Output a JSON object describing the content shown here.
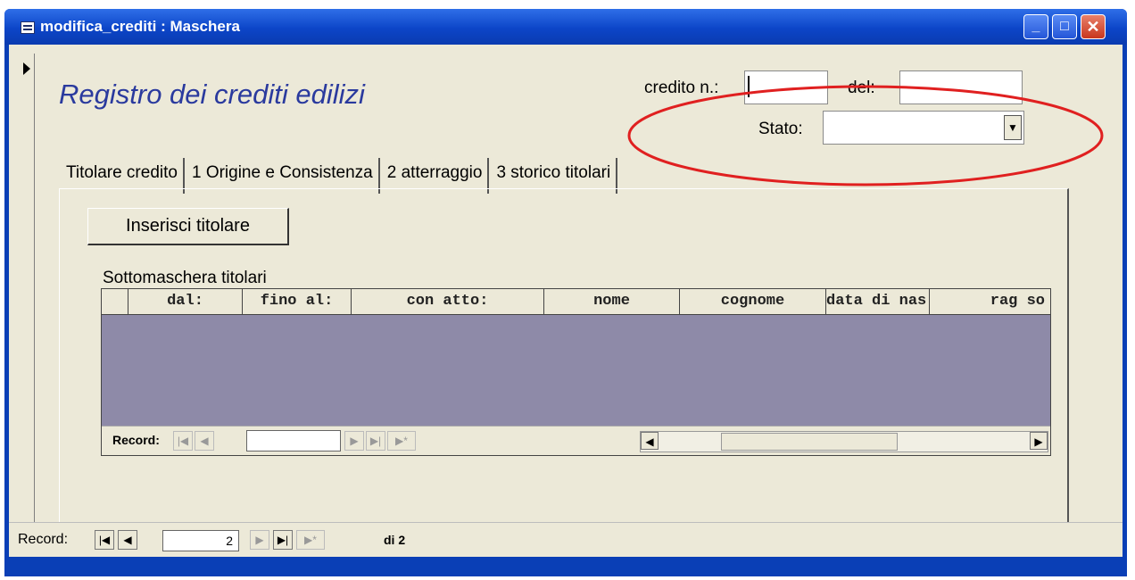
{
  "window": {
    "title": "modifica_crediti : Maschera",
    "buttons": {
      "minimize": "_",
      "maximize": "□",
      "close": "✕"
    }
  },
  "form": {
    "title": "Registro dei crediti edilizi",
    "credito_label": "credito n.:",
    "credito_value": "",
    "del_label": "del:",
    "del_value": "",
    "stato_label": "Stato:",
    "stato_value": ""
  },
  "tabs": [
    {
      "label": "Titolare credito"
    },
    {
      "label": "1 Origine e Consistenza"
    },
    {
      "label": "2 atterraggio"
    },
    {
      "label": "3 storico titolari"
    }
  ],
  "panel": {
    "insert_button": "Inserisci titolare",
    "subform_label": "Sottomaschera titolari",
    "columns": [
      "dal:",
      "fino al:",
      "con atto:",
      "nome",
      "cognome",
      "data di nas",
      "rag so"
    ],
    "sub_nav": {
      "label": "Record:",
      "value": ""
    }
  },
  "record_bar": {
    "label": "Record:",
    "current": "2",
    "total_label": "di 2"
  },
  "colors": {
    "title_bar": "#0a3fb6",
    "form_title": "#2a3a9e",
    "grid_body": "#8e8aa8",
    "annotation": "#e02020"
  },
  "icons": [
    "form-icon",
    "minimize-icon",
    "maximize-icon",
    "close-icon",
    "dropdown-arrow-icon",
    "first-record-icon",
    "prev-record-icon",
    "next-record-icon",
    "last-record-icon",
    "new-record-icon"
  ]
}
